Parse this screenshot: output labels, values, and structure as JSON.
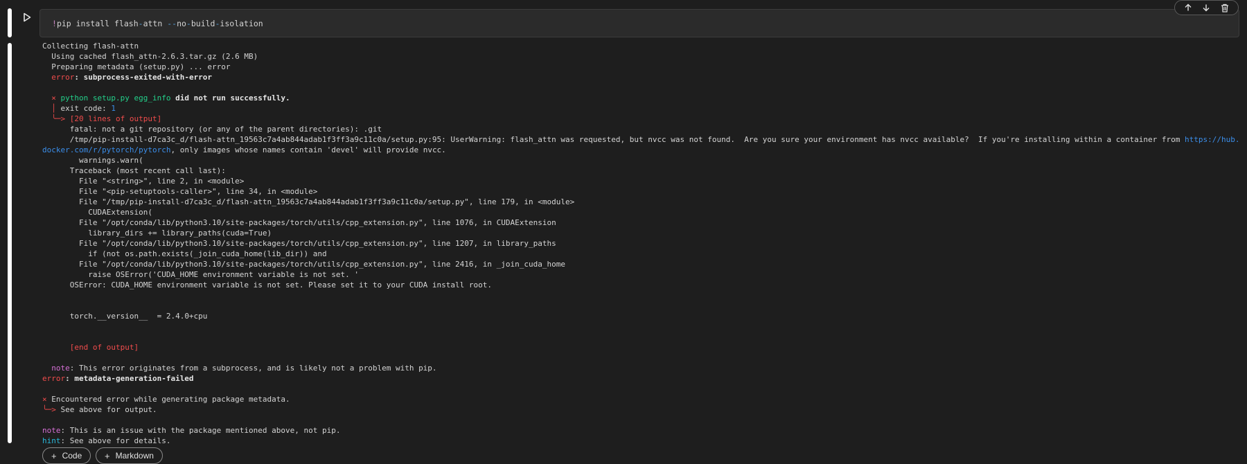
{
  "code_cell": {
    "bang": "!",
    "cmd_a": "pip install flash",
    "dash1": "-",
    "cmd_b": "attn ",
    "dash2": "--",
    "cmd_c": "no",
    "dash3": "-",
    "cmd_d": "build",
    "dash4": "-",
    "cmd_e": "isolation"
  },
  "output": {
    "l1": "Collecting flash-attn",
    "l2": "  Using cached flash_attn-2.6.3.tar.gz (2.6 MB)",
    "l3": "  Preparing metadata (setup.py) ... error",
    "l4_pre": "  ",
    "l4_err": "error",
    "l4_msg": ": subprocess-exited-with-error",
    "l6_pre": "  ",
    "l6_x": "×",
    "l6_cmd": " python setup.py egg_info",
    "l6_msg": " did not run successfully.",
    "l7_pre": "  ",
    "l7_bar": "│",
    "l7_msg": " exit code: ",
    "l7_code": "1",
    "l8_pre": "  ",
    "l8_msg": "╰─> [20 lines of output]",
    "l9": "      fatal: not a git repository (or any of the parent directories): .git",
    "l10_msg": "      /tmp/pip-install-d7ca3c_d/flash-attn_19563c7a4ab844adab1f3ff3a9c11c0a/setup.py:95: UserWarning: flash_attn was requested, but nvcc was not found.  Are you sure your environment has nvcc available?  If you're installing within a container from ",
    "l10_link_a": "https://hub.docker.com/r/pyt",
    "l10_link_b": "orch/pytorch",
    "l10_end": ", only images whose names contain 'devel' will provide nvcc.",
    "l11": "        warnings.warn(",
    "l12": "      Traceback (most recent call last):",
    "l13": "        File \"<string>\", line 2, in <module>",
    "l14": "        File \"<pip-setuptools-caller>\", line 34, in <module>",
    "l15": "        File \"/tmp/pip-install-d7ca3c_d/flash-attn_19563c7a4ab844adab1f3ff3a9c11c0a/setup.py\", line 179, in <module>",
    "l16": "          CUDAExtension(",
    "l17": "        File \"/opt/conda/lib/python3.10/site-packages/torch/utils/cpp_extension.py\", line 1076, in CUDAExtension",
    "l18": "          library_dirs += library_paths(cuda=True)",
    "l19": "        File \"/opt/conda/lib/python3.10/site-packages/torch/utils/cpp_extension.py\", line 1207, in library_paths",
    "l20": "          if (not os.path.exists(_join_cuda_home(lib_dir)) and",
    "l21": "        File \"/opt/conda/lib/python3.10/site-packages/torch/utils/cpp_extension.py\", line 2416, in _join_cuda_home",
    "l22": "          raise OSError('CUDA_HOME environment variable is not set. '",
    "l23": "      OSError: CUDA_HOME environment variable is not set. Please set it to your CUDA install root.",
    "l26": "      torch.__version__  = 2.4.0+cpu",
    "l29": "      [end of output]",
    "l31_pre": "  ",
    "l31_note": "note",
    "l31_msg": ": This error originates from a subprocess, and is likely not a problem with pip.",
    "l32_err": "error",
    "l32_msg": ": metadata-generation-failed",
    "l34_x": "×",
    "l34_msg": " Encountered error while generating package metadata.",
    "l35_arrow": "╰─>",
    "l35_msg": " See above for output.",
    "l37_note": "note",
    "l37_msg": ": This is an issue with the package mentioned above, not pip.",
    "l38_hint": "hint",
    "l38_msg": ": See above for details."
  },
  "add_cell": {
    "code_label": "Code",
    "markdown_label": "Markdown"
  }
}
